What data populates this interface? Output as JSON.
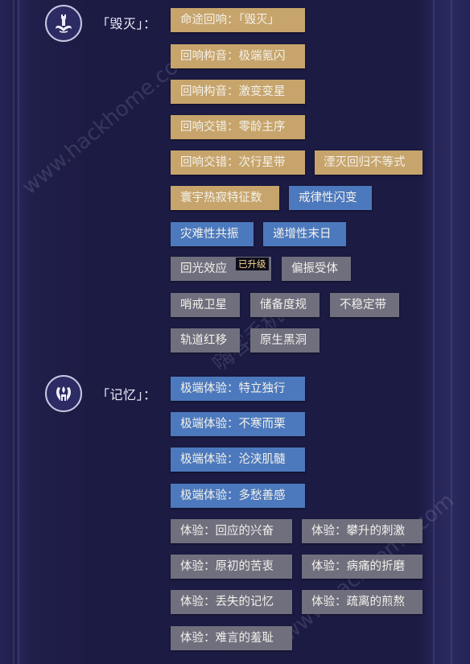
{
  "watermarks": [
    "www.hackhome.com",
    "嗨客手机站",
    "www.hackhome.com"
  ],
  "sections": [
    {
      "id": "destruction",
      "label": "「毁灭」：",
      "emblem_icon": "destruction-path-icon",
      "tags": [
        {
          "text": "命途回响：「毁灭」",
          "color": "gold"
        },
        {
          "text": "回响构音：极端氪闪",
          "color": "gold"
        },
        {
          "text": "回响构音：激变变星",
          "color": "gold"
        },
        {
          "text": "回响交错：零龄主序",
          "color": "gold"
        },
        {
          "text": "回响交错：次行星带",
          "color": "gold"
        },
        {
          "text": "湮灭回归不等式",
          "color": "gold"
        },
        {
          "text": "寰宇热寂特征数",
          "color": "gold"
        },
        {
          "text": "戒律性闪变",
          "color": "blue"
        },
        {
          "text": "灾难性共振",
          "color": "blue"
        },
        {
          "text": "递增性末日",
          "color": "blue"
        },
        {
          "text": "回光效应",
          "color": "gray",
          "badge": "已升级"
        },
        {
          "text": "偏振受体",
          "color": "gray"
        },
        {
          "text": "哨戒卫星",
          "color": "gray"
        },
        {
          "text": "储备度规",
          "color": "gray"
        },
        {
          "text": "不稳定带",
          "color": "gray"
        },
        {
          "text": "轨道红移",
          "color": "gray"
        },
        {
          "text": "原生黑洞",
          "color": "gray"
        }
      ]
    },
    {
      "id": "remembrance",
      "label": "「记忆」：",
      "emblem_icon": "remembrance-path-icon",
      "tags": [
        {
          "text": "极端体验：特立独行",
          "color": "blue"
        },
        {
          "text": "极端体验：不寒而栗",
          "color": "blue"
        },
        {
          "text": "极端体验：沦浃肌髓",
          "color": "blue"
        },
        {
          "text": "极端体验：多愁善感",
          "color": "blue"
        },
        {
          "text": "体验：回应的兴奋",
          "color": "gray"
        },
        {
          "text": "体验：攀升的刺激",
          "color": "gray"
        },
        {
          "text": "体验：原初的苦衷",
          "color": "gray"
        },
        {
          "text": "体验：病痛的折磨",
          "color": "gray"
        },
        {
          "text": "体验：丢失的记忆",
          "color": "gray"
        },
        {
          "text": "体验：疏离的煎熬",
          "color": "gray"
        },
        {
          "text": "体验：难言的羞耻",
          "color": "gray"
        }
      ]
    }
  ],
  "colors": {
    "background": "#1e1d44",
    "gold": "#c6a46b",
    "blue": "#4c79bd",
    "gray": "#6f6f7e",
    "badge_text": "#f4d58a"
  }
}
